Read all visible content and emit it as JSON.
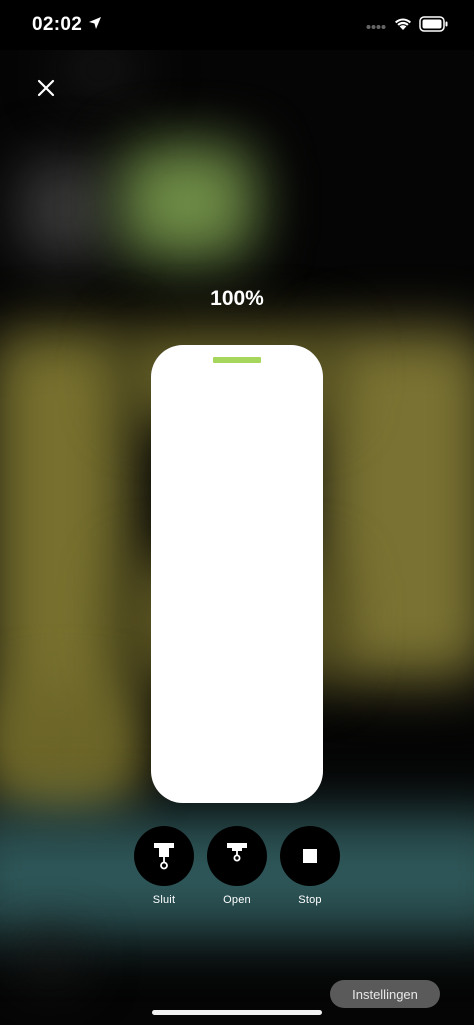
{
  "status_bar": {
    "time": "02:02",
    "icons": [
      "location-arrow-icon",
      "cellular-signal-icon",
      "wifi-icon",
      "battery-icon"
    ]
  },
  "close_icon": "close-icon",
  "position": {
    "label": "100%",
    "level_percent": 100
  },
  "colors": {
    "handle": "#a7d65d",
    "fill": "#ffffff",
    "track": "#3c3c3c"
  },
  "controls": {
    "close": {
      "label": "Sluit",
      "icon": "blind-close-icon"
    },
    "open": {
      "label": "Open",
      "icon": "blind-open-icon"
    },
    "stop": {
      "label": "Stop",
      "icon": "stop-square-icon"
    }
  },
  "settings": {
    "label": "Instellingen"
  }
}
